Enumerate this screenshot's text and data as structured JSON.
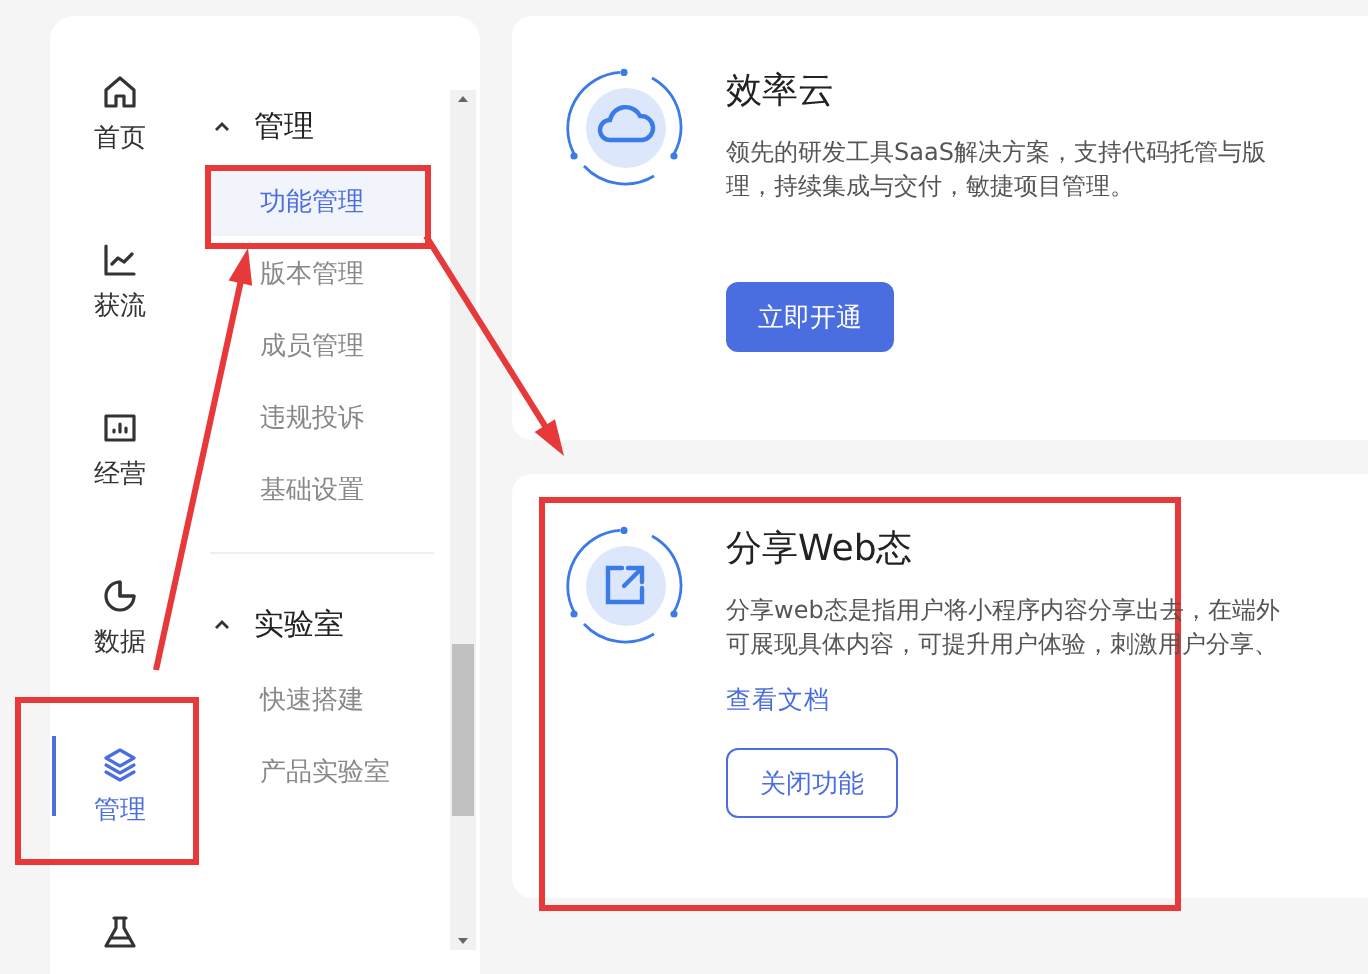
{
  "rail": [
    {
      "label": "首页",
      "selected": false
    },
    {
      "label": "获流",
      "selected": false
    },
    {
      "label": "经营",
      "selected": false
    },
    {
      "label": "数据",
      "selected": false
    },
    {
      "label": "管理",
      "selected": true
    },
    {
      "selected": false
    }
  ],
  "submenu": {
    "groups": [
      {
        "title": "管理",
        "expanded": true,
        "items": [
          {
            "label": "功能管理",
            "selected": true
          },
          {
            "label": "版本管理",
            "selected": false
          },
          {
            "label": "成员管理",
            "selected": false
          },
          {
            "label": "违规投诉",
            "selected": false
          },
          {
            "label": "基础设置",
            "selected": false
          }
        ]
      },
      {
        "title": "实验室",
        "expanded": true,
        "items": [
          {
            "label": "快速搭建",
            "selected": false
          },
          {
            "label": "产品实验室",
            "selected": false
          }
        ]
      }
    ]
  },
  "cards": [
    {
      "title": "效率云",
      "description": [
        "领先的研发工具SaaS解决方案，支持代码托管与版",
        "理，持续集成与交付，敏捷项目管理。"
      ],
      "button": {
        "label": "立即开通",
        "kind": "primary"
      }
    },
    {
      "title": "分享Web态",
      "description": [
        "分享web态是指用户将小程序内容分享出去，在端外",
        "可展现具体内容，可提升用户体验，刺激用户分享、"
      ],
      "link": "查看文档",
      "button": {
        "label": "关闭功能",
        "kind": "outline"
      }
    }
  ]
}
